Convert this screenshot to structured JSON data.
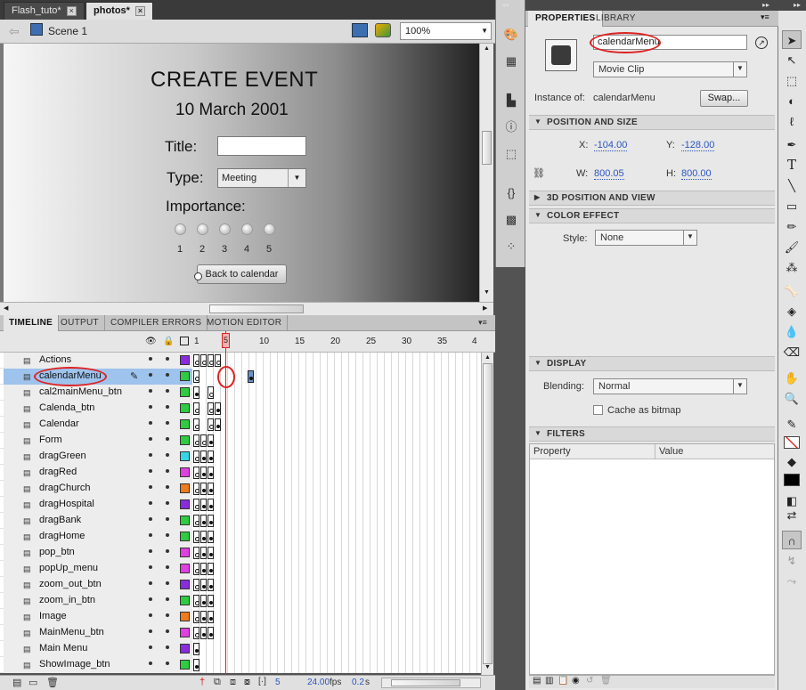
{
  "document_tabs": [
    {
      "label": "Flash_tuto*",
      "active": false
    },
    {
      "label": "photos*",
      "active": true
    }
  ],
  "edit_bar": {
    "scene": "Scene 1",
    "zoom": "100%"
  },
  "stage": {
    "heading": "CREATE EVENT",
    "date": "10  March 2001",
    "title_label": "Title:",
    "type_label": "Type:",
    "type_value": "Meeting",
    "importance_label": "Importance:",
    "importance_options": [
      "1",
      "2",
      "3",
      "4",
      "5"
    ],
    "back_button": "Back to calendar"
  },
  "timeline": {
    "tabs": [
      "TIMELINE",
      "OUTPUT",
      "COMPILER ERRORS",
      "MOTION EDITOR"
    ],
    "frame_numbers": [
      "1",
      "5",
      "10",
      "15",
      "20",
      "25",
      "30",
      "35",
      "4"
    ],
    "current_frame": "5",
    "layers": [
      {
        "name": "Actions",
        "color": "#8a2be2",
        "selected": false
      },
      {
        "name": "calendarMenu",
        "color": "#2ecc40",
        "selected": true
      },
      {
        "name": "cal2mainMenu_btn",
        "color": "#2ecc40",
        "selected": false
      },
      {
        "name": "Calenda_btn",
        "color": "#2ecc40",
        "selected": false
      },
      {
        "name": "Calendar",
        "color": "#2ecc40",
        "selected": false
      },
      {
        "name": "Form",
        "color": "#2ecc40",
        "selected": false
      },
      {
        "name": "dragGreen",
        "color": "#35d6e8",
        "selected": false
      },
      {
        "name": "dragRed",
        "color": "#e040e0",
        "selected": false
      },
      {
        "name": "dragChurch",
        "color": "#f07a1c",
        "selected": false
      },
      {
        "name": "dragHospital",
        "color": "#8a2be2",
        "selected": false
      },
      {
        "name": "dragBank",
        "color": "#2ecc40",
        "selected": false
      },
      {
        "name": "dragHome",
        "color": "#2ecc40",
        "selected": false
      },
      {
        "name": "pop_btn",
        "color": "#e040e0",
        "selected": false
      },
      {
        "name": "popUp_menu",
        "color": "#e040e0",
        "selected": false
      },
      {
        "name": "zoom_out_btn",
        "color": "#8a2be2",
        "selected": false
      },
      {
        "name": "zoom_in_btn",
        "color": "#2ecc40",
        "selected": false
      },
      {
        "name": "Image",
        "color": "#f07a1c",
        "selected": false
      },
      {
        "name": "MainMenu_btn",
        "color": "#e040e0",
        "selected": false
      },
      {
        "name": "Main Menu",
        "color": "#8a2be2",
        "selected": false
      },
      {
        "name": "ShowImage_btn",
        "color": "#2ecc40",
        "selected": false
      }
    ],
    "footer": {
      "frame": "5",
      "fps_value": "24.00",
      "fps_unit": "fps",
      "time": "0.2",
      "time_unit": "s"
    }
  },
  "properties": {
    "tabs": [
      "PROPERTIES",
      "LIBRARY"
    ],
    "instance_name": "calendarMenu",
    "symbol_type": "Movie Clip",
    "instance_of_label": "Instance of:",
    "instance_of_value": "calendarMenu",
    "swap_button": "Swap...",
    "position_section": "POSITION AND SIZE",
    "x_label": "X:",
    "x_value": "-104.00",
    "y_label": "Y:",
    "y_value": "-128.00",
    "w_label": "W:",
    "w_value": "800.05",
    "h_label": "H:",
    "h_value": "800.00",
    "pos3d_section": "3D POSITION AND VIEW",
    "color_section": "COLOR EFFECT",
    "style_label": "Style:",
    "style_value": "None",
    "display_section": "DISPLAY",
    "blending_label": "Blending:",
    "blending_value": "Normal",
    "cache_label": "Cache as bitmap",
    "filters_section": "FILTERS",
    "filters_col_property": "Property",
    "filters_col_value": "Value"
  },
  "colors": {
    "accent_ring": "#dd2222",
    "selection": "#9ec3ec",
    "link_value": "#2a55c0"
  }
}
